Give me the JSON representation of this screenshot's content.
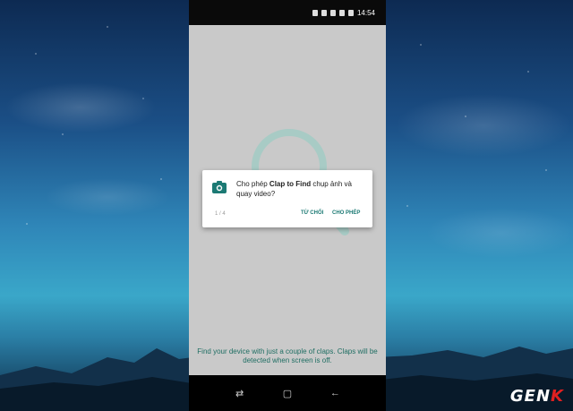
{
  "status_bar": {
    "time": "14:54"
  },
  "dialog": {
    "message_pre": "Cho phép ",
    "app_name": "Clap to Find",
    "message_post": " chụp ảnh và quay video?",
    "counter": "1 / 4",
    "deny_label": "TỪ CHỐI",
    "allow_label": "CHO PHÉP",
    "icon": "camera-icon",
    "accent_color": "#1c7a74"
  },
  "app": {
    "footer_text": "Find your device with just a couple of claps. Claps will be detected when screen is off.",
    "background_color": "#c9c9c9",
    "footer_color": "#1f6e63"
  },
  "nav_bar": {
    "recents": "⇄",
    "home": "▢",
    "back": "←"
  },
  "watermark": {
    "left": "GEN",
    "right": "K"
  }
}
